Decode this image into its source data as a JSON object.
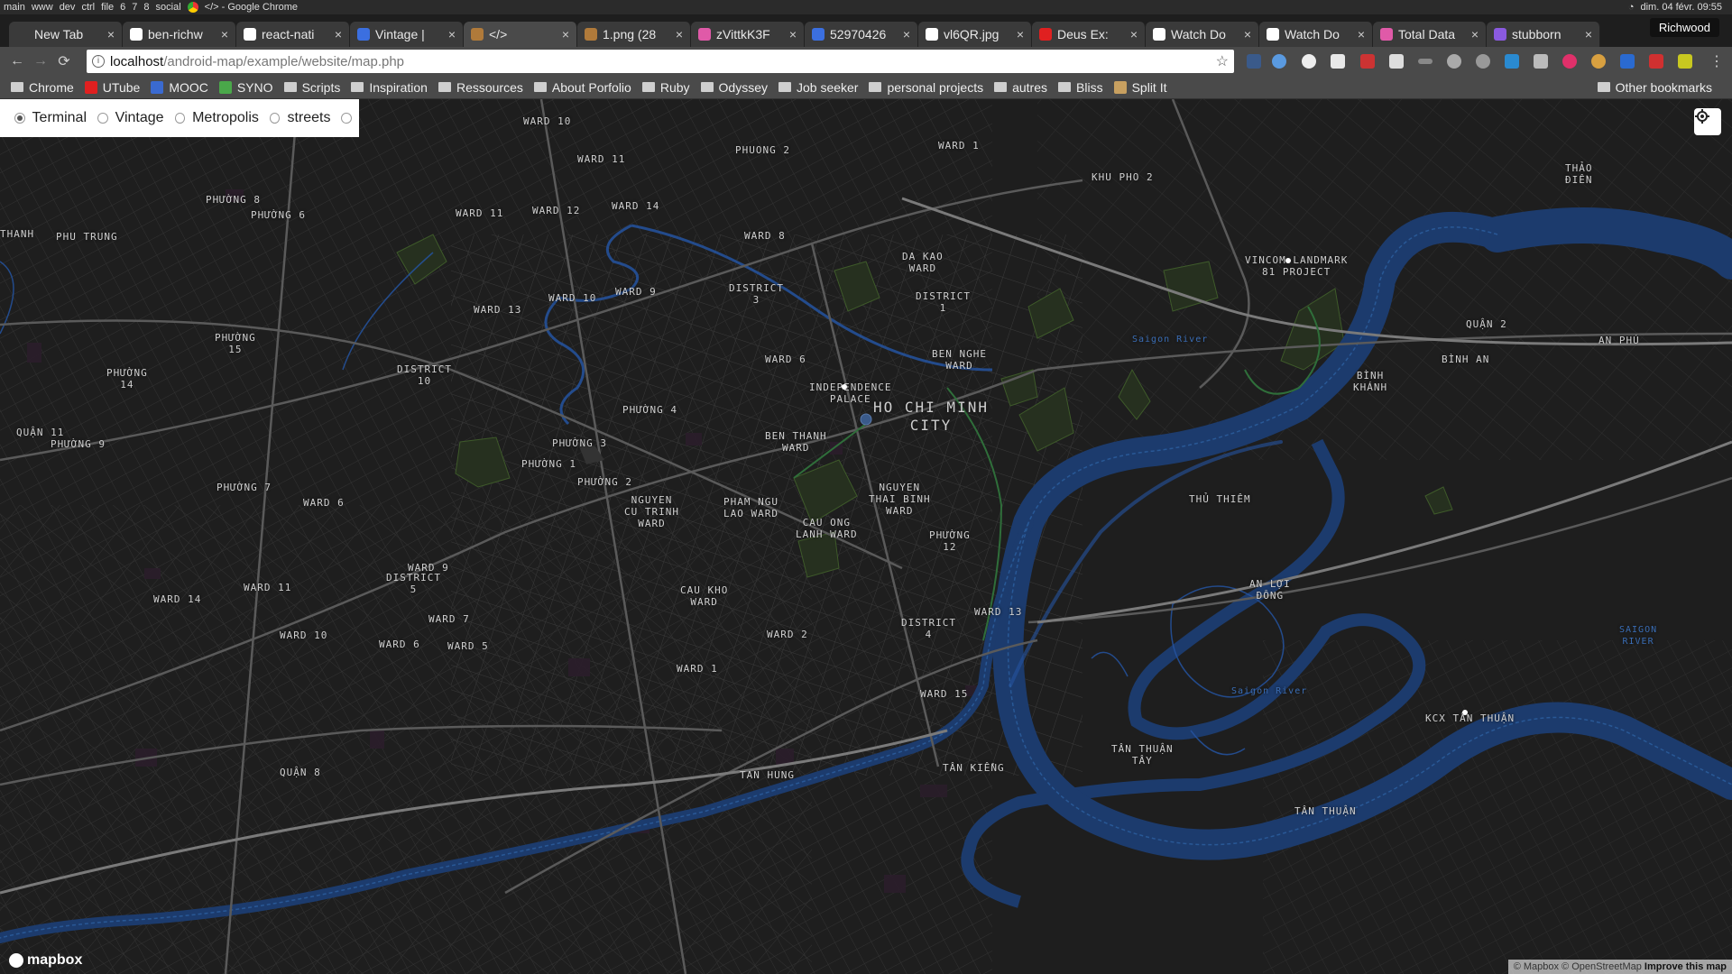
{
  "sysbar": {
    "items": [
      "main",
      "www",
      "dev",
      "ctrl",
      "file",
      "6",
      "7",
      "8",
      "social"
    ],
    "window_title": "</> - Google Chrome",
    "datetime": "dim. 04 févr. 09:55"
  },
  "tabs": [
    {
      "label": "New Tab",
      "color": "#3a3a3a"
    },
    {
      "label": "ben-richw",
      "color": "#ffffff"
    },
    {
      "label": "react-nati",
      "color": "#ffffff"
    },
    {
      "label": "Vintage |",
      "color": "#3b6fe0"
    },
    {
      "label": "</>",
      "color": "#b07a3a"
    },
    {
      "label": "1.png (28",
      "color": "#b07a3a"
    },
    {
      "label": "zVittkK3F",
      "color": "#e05aa8"
    },
    {
      "label": "52970426",
      "color": "#3b6fe0"
    },
    {
      "label": "vl6QR.jpg",
      "color": "#ffffff"
    },
    {
      "label": "Deus Ex:",
      "color": "#e02020"
    },
    {
      "label": "Watch Do",
      "color": "#ffffff"
    },
    {
      "label": "Watch Do",
      "color": "#ffffff"
    },
    {
      "label": "Total Data",
      "color": "#e05aa8"
    },
    {
      "label": "stubborn",
      "color": "#8a5ae0"
    }
  ],
  "profile": "Richwood",
  "address": {
    "host": "localhost",
    "path": "/android-map/example/website/map.php"
  },
  "bookmarks": [
    {
      "label": "Chrome",
      "type": "folder"
    },
    {
      "label": "UTube",
      "type": "red"
    },
    {
      "label": "MOOC",
      "type": "blue"
    },
    {
      "label": "SYNO",
      "type": "green"
    },
    {
      "label": "Scripts",
      "type": "folder"
    },
    {
      "label": "Inspiration",
      "type": "folder"
    },
    {
      "label": "Ressources",
      "type": "folder"
    },
    {
      "label": "About Porfolio",
      "type": "folder"
    },
    {
      "label": "Ruby",
      "type": "folder"
    },
    {
      "label": "Odyssey",
      "type": "folder"
    },
    {
      "label": "Job seeker",
      "type": "folder"
    },
    {
      "label": "personal projects",
      "type": "folder"
    },
    {
      "label": "autres",
      "type": "folder"
    },
    {
      "label": "Bliss",
      "type": "folder"
    },
    {
      "label": "Split It",
      "type": "page"
    }
  ],
  "other_bookmarks": "Other bookmarks",
  "map": {
    "styles": [
      {
        "label": "Terminal",
        "selected": true
      },
      {
        "label": "Vintage",
        "selected": false
      },
      {
        "label": "Metropolis",
        "selected": false
      },
      {
        "label": "streets",
        "selected": false
      }
    ],
    "city_label": "HO CHI MINH\nCITY",
    "labels": [
      "PHUONG 2",
      "WARD 10",
      "WARD 11",
      "WARD 1",
      "KHU PHO 2",
      "THẢO\nĐIỀN",
      "PHƯỜNG 8",
      "PHƯỜNG 6",
      "THANH",
      "PHU TRUNG",
      "WARD 11",
      "WARD 12",
      "WARD 14",
      "WARD 8",
      "DA KAO\nWARD",
      "VINCOM LANDMARK\n81 PROJECT",
      "WARD 9",
      "DISTRICT\n3",
      "WARD 10",
      "DISTRICT\n1",
      "WARD 13",
      "QUẬN 2",
      "PHƯỜNG\n15",
      "BEN NGHE\nWARD",
      "AN PHÚ",
      "WARD 6",
      "BÌNH AN",
      "DISTRICT\n10",
      "PHƯỜNG\n14",
      "BÌNH\nKHÁNH",
      "INDEPENDENCE\nPALACE",
      "PHƯỜNG 4",
      "QUẬN 11",
      "PHƯỜNG 3",
      "PHƯỜNG 9",
      "BEN THANH\nWARD",
      "PHƯỜNG 1",
      "PHƯỜNG 2",
      "PHƯỜNG 7",
      "NGUYEN\nTHAI BINH\nWARD",
      "THỦ THIÊM",
      "WARD 6",
      "NGUYEN\nCU TRINH\nWARD",
      "PHAM NGU\nLAO WARD",
      "CAU ONG\nLANH WARD",
      "PHƯỜNG\n12",
      "WARD 9",
      "DISTRICT\n5",
      "WARD 11",
      "WARD 14",
      "CAU KHO\nWARD",
      "AN LỢI\nĐÔNG",
      "WARD 7",
      "WARD 13",
      "WARD 10",
      "WARD 6",
      "WARD 5",
      "WARD 2",
      "DISTRICT\n4",
      "WARD 1",
      "WARD 15",
      "SAIGON\nRIVER",
      "KCX TÂN THUẬN",
      "QUẬN 8",
      "TAN HUNG",
      "TÂN KIỂNG",
      "TÂN THUẬN\nTÂY",
      "TÂN THUẬN",
      "Saigon River",
      "Saigon River"
    ],
    "attribution": "© Mapbox © OpenStreetMap",
    "improve": "Improve this map",
    "logo": "mapbox"
  }
}
